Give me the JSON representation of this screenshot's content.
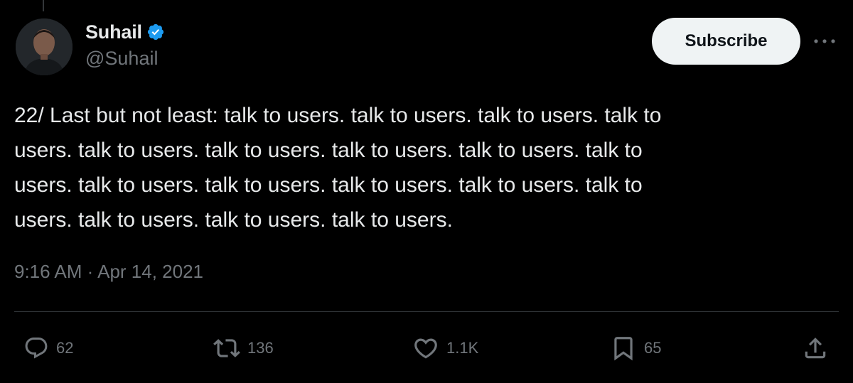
{
  "author": {
    "display_name": "Suhail",
    "handle": "@Suhail",
    "verified": true
  },
  "subscribe_label": "Subscribe",
  "tweet": {
    "text": "22/ Last but not least: talk to users. talk to users. talk to users. talk to\nusers. talk to users. talk to users. talk to users. talk to users. talk to\nusers. talk to users. talk to users. talk to users. talk to users. talk to\nusers. talk to users. talk to users. talk to users.",
    "time": "9:16 AM",
    "separator": "·",
    "date": "Apr 14, 2021"
  },
  "actions": {
    "replies": "62",
    "reposts": "136",
    "likes": "1.1K",
    "bookmarks": "65"
  },
  "icons": {
    "verified": "verified-badge-icon",
    "more": "more-icon",
    "reply": "reply-icon",
    "repost": "repost-icon",
    "like": "heart-icon",
    "bookmark": "bookmark-icon",
    "share": "share-icon"
  },
  "colors": {
    "background": "#000000",
    "text": "#e7e9ea",
    "secondary": "#71767b",
    "verified": "#1d9bf0",
    "button_bg": "#eff3f4",
    "divider": "#2f3336"
  }
}
